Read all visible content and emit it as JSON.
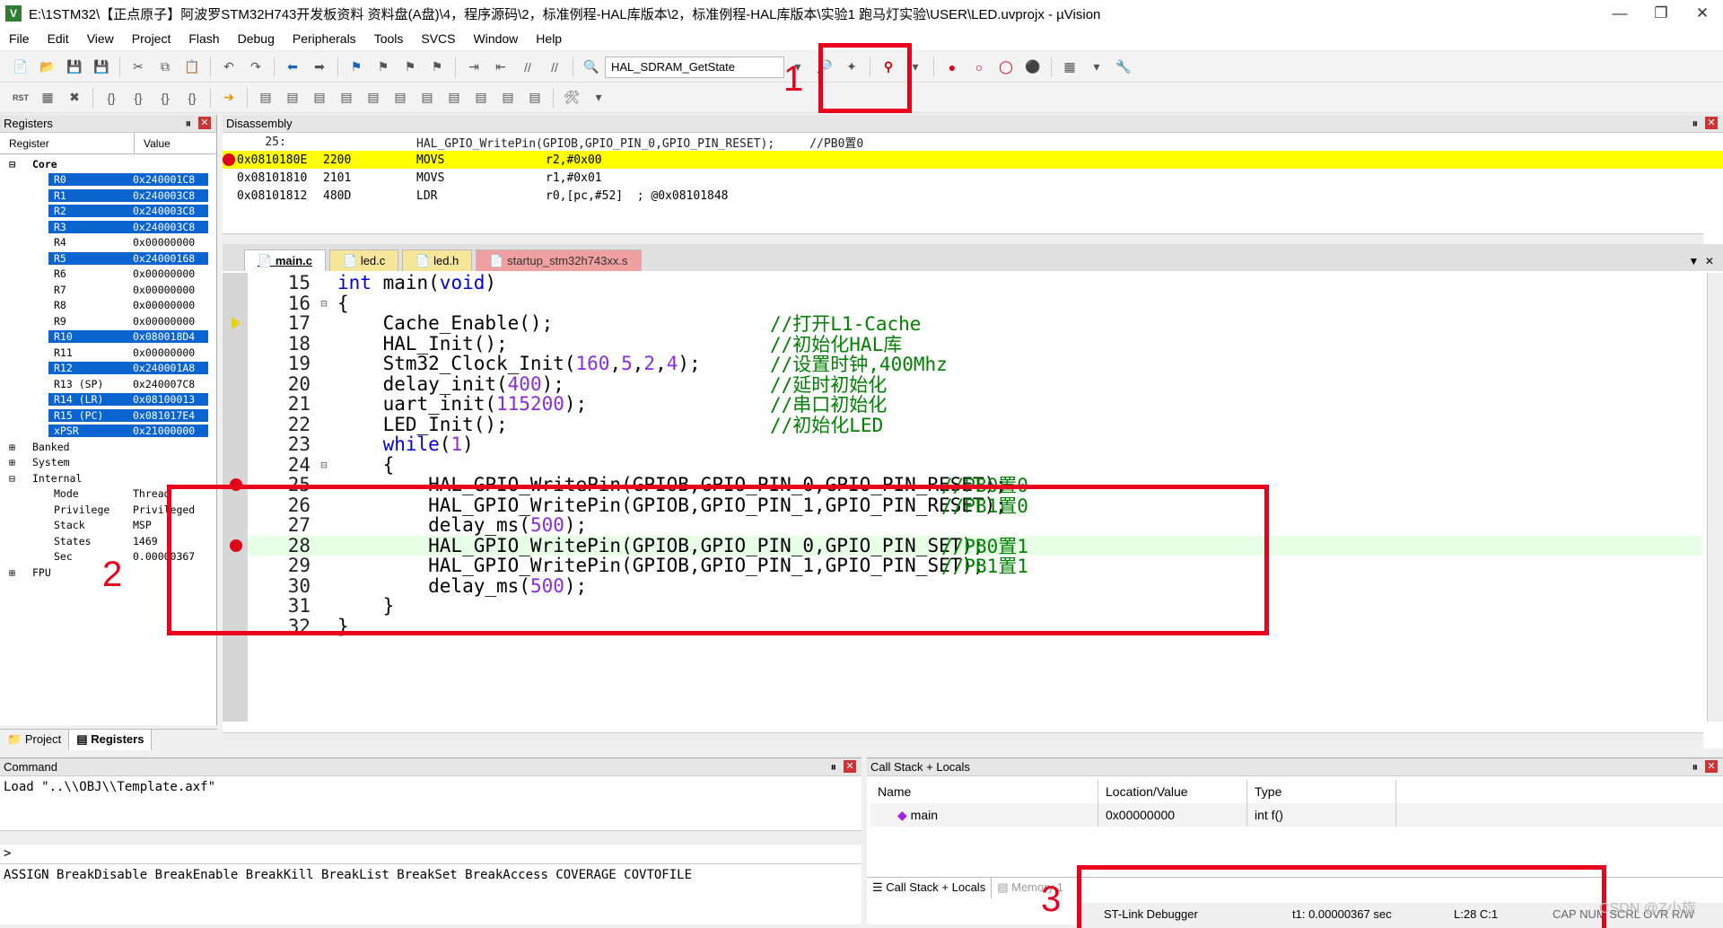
{
  "window": {
    "title": "E:\\1STM32\\【正点原子】阿波罗STM32H743开发板资料 资料盘(A盘)\\4，程序源码\\2，标准例程-HAL库版本\\2，标准例程-HAL库版本\\实验1 跑马灯实验\\USER\\LED.uvprojx - µVision",
    "app_icon": "V"
  },
  "menu": [
    "File",
    "Edit",
    "View",
    "Project",
    "Flash",
    "Debug",
    "Peripherals",
    "Tools",
    "SVCS",
    "Window",
    "Help"
  ],
  "toolbar": {
    "function_combo": "HAL_SDRAM_GetState"
  },
  "registers": {
    "header": "Registers",
    "col_register": "Register",
    "col_value": "Value",
    "groups": [
      "Core",
      "Banked",
      "System",
      "Internal",
      "FPU"
    ],
    "core": [
      {
        "name": "R0",
        "value": "0x240001C8"
      },
      {
        "name": "R1",
        "value": "0x240003C8"
      },
      {
        "name": "R2",
        "value": "0x240003C8"
      },
      {
        "name": "R3",
        "value": "0x240003C8"
      },
      {
        "name": "R4",
        "value": "0x00000000"
      },
      {
        "name": "R5",
        "value": "0x24000168"
      },
      {
        "name": "R6",
        "value": "0x00000000"
      },
      {
        "name": "R7",
        "value": "0x00000000"
      },
      {
        "name": "R8",
        "value": "0x00000000"
      },
      {
        "name": "R9",
        "value": "0x00000000"
      },
      {
        "name": "R10",
        "value": "0x080018D4"
      },
      {
        "name": "R11",
        "value": "0x00000000"
      },
      {
        "name": "R12",
        "value": "0x240001A8"
      },
      {
        "name": "R13 (SP)",
        "value": "0x240007C8"
      },
      {
        "name": "R14 (LR)",
        "value": "0x08100013"
      },
      {
        "name": "R15 (PC)",
        "value": "0x081017E4"
      },
      {
        "name": "xPSR",
        "value": "0x21000000"
      }
    ],
    "internal": [
      {
        "name": "Mode",
        "value": "Thread"
      },
      {
        "name": "Privilege",
        "value": "Privileged"
      },
      {
        "name": "Stack",
        "value": "MSP"
      },
      {
        "name": "States",
        "value": "1469"
      },
      {
        "name": "Sec",
        "value": "0.00000367"
      }
    ],
    "tabs": [
      "Project",
      "Registers"
    ]
  },
  "disassembly": {
    "header": "Disassembly",
    "lines": [
      {
        "addr": "    25:",
        "op": "",
        "mn": "",
        "args": "HAL_GPIO_WritePin(GPIOB,GPIO_PIN_0,GPIO_PIN_RESET);     //PB0置0"
      },
      {
        "addr": "0x0810180E",
        "op": "2200",
        "mn": "MOVS",
        "args": "r2,#0x00"
      },
      {
        "addr": "0x08101810",
        "op": "2101",
        "mn": "MOVS",
        "args": "r1,#0x01"
      },
      {
        "addr": "0x08101812",
        "op": "480D",
        "mn": "LDR",
        "args": "r0,[pc,#52]  ; @0x08101848"
      }
    ]
  },
  "editor": {
    "tabs": [
      "main.c",
      "led.c",
      "led.h",
      "startup_stm32h743xx.s"
    ],
    "lines": [
      {
        "n": "15",
        "code": "int main(void)"
      },
      {
        "n": "16",
        "code": "{"
      },
      {
        "n": "17",
        "code": "    Cache_Enable();",
        "comment": "//打开L1-Cache"
      },
      {
        "n": "18",
        "code": "    HAL_Init();",
        "comment": "//初始化HAL库"
      },
      {
        "n": "19",
        "code": "    Stm32_Clock_Init(160,5,2,4);",
        "comment": "//设置时钟,400Mhz"
      },
      {
        "n": "20",
        "code": "    delay_init(400);",
        "comment": "//延时初始化"
      },
      {
        "n": "21",
        "code": "    uart_init(115200);",
        "comment": "//串口初始化"
      },
      {
        "n": "22",
        "code": "    LED_Init();",
        "comment": "//初始化LED"
      },
      {
        "n": "23",
        "code": "    while(1)"
      },
      {
        "n": "24",
        "code": "    {"
      },
      {
        "n": "25",
        "code": "        HAL_GPIO_WritePin(GPIOB,GPIO_PIN_0,GPIO_PIN_RESET);",
        "comment": "//PB0置0"
      },
      {
        "n": "26",
        "code": "        HAL_GPIO_WritePin(GPIOB,GPIO_PIN_1,GPIO_PIN_RESET);",
        "comment": "//PB1置0"
      },
      {
        "n": "27",
        "code": "        delay_ms(500);"
      },
      {
        "n": "28",
        "code": "        HAL_GPIO_WritePin(GPIOB,GPIO_PIN_0,GPIO_PIN_SET);",
        "comment": "//PB0置1"
      },
      {
        "n": "29",
        "code": "        HAL_GPIO_WritePin(GPIOB,GPIO_PIN_1,GPIO_PIN_SET);",
        "comment": "//PB1置1"
      },
      {
        "n": "30",
        "code": "        delay_ms(500);"
      },
      {
        "n": "31",
        "code": "    }"
      },
      {
        "n": "32",
        "code": "}"
      }
    ]
  },
  "command": {
    "header": "Command",
    "output": "Load \"..\\\\OBJ\\\\Template.axf\"",
    "prompt": ">",
    "hints": "ASSIGN BreakDisable BreakEnable BreakKill BreakList BreakSet BreakAccess COVERAGE COVTOFILE"
  },
  "callstack": {
    "header": "Call Stack + Locals",
    "cols": [
      "Name",
      "Location/Value",
      "Type"
    ],
    "row": {
      "name": "main",
      "value": "0x00000000",
      "type": "int f()"
    },
    "tabs": [
      "Call Stack + Locals",
      "Memory 1"
    ]
  },
  "status": {
    "debugger": "ST-Link Debugger",
    "time": "t1: 0.00000367 sec",
    "pos": "L:28 C:1",
    "flags": "CAP  NUM  SCRL  OVR  R/W"
  },
  "annotations": [
    "1",
    "2",
    "3"
  ],
  "watermark": "CSDN @Z小旋",
  "colors": {
    "highlight": "#ffff00",
    "breakpoint": "#e0001b",
    "selection": "#0a64d0",
    "annotation": "#e8001c",
    "current_line": "#e6ffe6"
  }
}
